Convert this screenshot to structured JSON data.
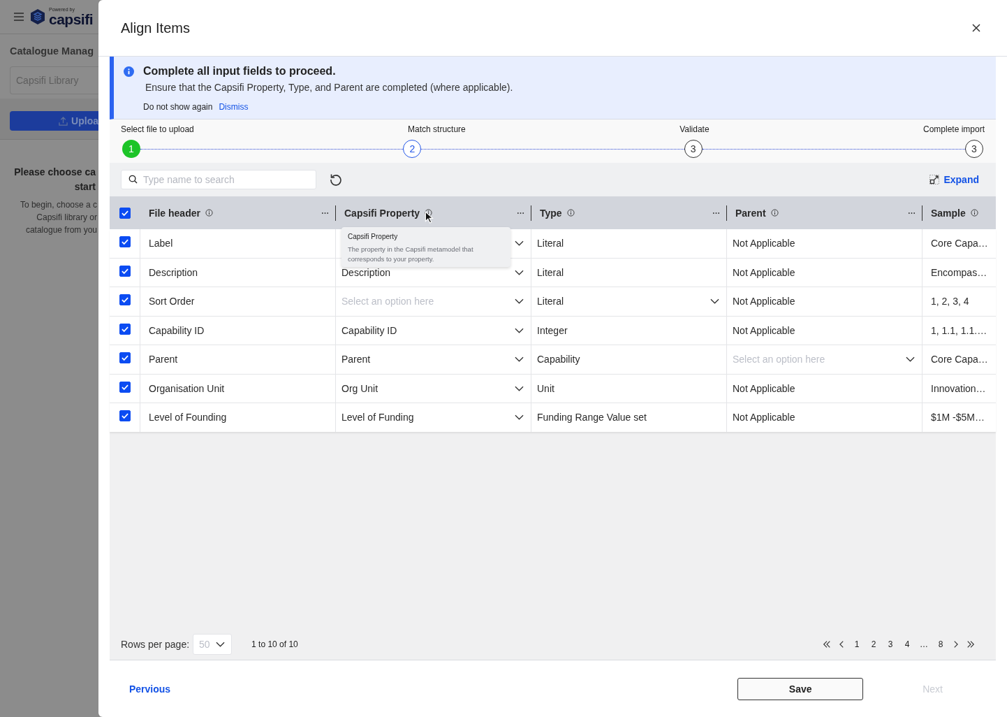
{
  "background_page": {
    "logo": {
      "tagline": "Powered by",
      "name": "capsifi"
    },
    "title": "Catalogue Manag",
    "library_field": {
      "placeholder": "Capsifi Library"
    },
    "upload_button": "Uploa",
    "empty_state": {
      "heading_lines": [
        "Please choose ca",
        "start"
      ],
      "body_lines": [
        "To begin, choose a c",
        "Capsifi library or",
        "catalogue from you"
      ]
    }
  },
  "dialog": {
    "title": "Align Items"
  },
  "alert": {
    "title": "Complete all input fields to proceed.",
    "message": "Ensure that the Capsifi Property, Type, and Parent are completed (where applicable).",
    "opt_out": "Do not show again",
    "dismiss": "Dismiss"
  },
  "steps": [
    {
      "label": "Select file to upload",
      "number": "1",
      "completed": true,
      "selected": false
    },
    {
      "label": "Match structure",
      "number": "2",
      "completed": false,
      "selected": true
    },
    {
      "label": "Validate",
      "number": "3",
      "completed": false,
      "selected": false
    },
    {
      "label": "Complete import",
      "number": "3",
      "completed": false,
      "selected": false
    }
  ],
  "search": {
    "placeholder": "Type name to search"
  },
  "expand": "Expand",
  "table": {
    "all_checked": true,
    "columns": [
      {
        "label": "File header",
        "menu": true
      },
      {
        "label": "Capsifi Property",
        "menu": true
      },
      {
        "label": "Type",
        "menu": true
      },
      {
        "label": "Parent",
        "menu": true
      },
      {
        "label": "Sample",
        "menu": false
      }
    ],
    "rows": [
      {
        "checked": true,
        "file_header": "Label",
        "property": {
          "dropdown": true
        },
        "type": {
          "value": "Literal",
          "dropdown": false
        },
        "parent": {
          "value": "Not Applicable",
          "dropdown": false
        },
        "sample": "Core Capa…"
      },
      {
        "checked": true,
        "file_header": "Description",
        "property": {
          "value": "Description",
          "dropdown": true
        },
        "type": {
          "value": "Literal",
          "dropdown": false
        },
        "parent": {
          "value": "Not Applicable",
          "dropdown": false
        },
        "sample": "Encompas…"
      },
      {
        "checked": true,
        "file_header": "Sort Order",
        "property": {
          "placeholder": "Select an option here",
          "dropdown": true
        },
        "type": {
          "value": "Literal",
          "dropdown": true
        },
        "parent": {
          "value": "Not Applicable",
          "dropdown": false
        },
        "sample": "1, 2, 3, 4"
      },
      {
        "checked": true,
        "file_header": "Capability ID",
        "property": {
          "value": "Capability ID",
          "dropdown": true
        },
        "type": {
          "value": "Integer",
          "dropdown": false
        },
        "parent": {
          "value": "Not Applicable",
          "dropdown": false
        },
        "sample": "1, 1.1, 1.1.…"
      },
      {
        "checked": true,
        "file_header": "Parent",
        "property": {
          "value": "Parent",
          "dropdown": true
        },
        "type": {
          "value": "Capability",
          "dropdown": false
        },
        "parent": {
          "placeholder": "Select an option here",
          "dropdown": true
        },
        "sample": "Core Capa…"
      },
      {
        "checked": true,
        "file_header": "Organisation Unit",
        "property": {
          "value": "Org Unit",
          "dropdown": true
        },
        "type": {
          "value": "Unit",
          "dropdown": false
        },
        "parent": {
          "value": "Not Applicable",
          "dropdown": false
        },
        "sample": "Innovation…"
      },
      {
        "checked": true,
        "file_header": "Level of Founding",
        "property": {
          "value": "Level of Funding",
          "dropdown": true
        },
        "type": {
          "value": "Funding Range Value set",
          "dropdown": false
        },
        "parent": {
          "value": "Not Applicable",
          "dropdown": false
        },
        "sample": "$1M -$5M…"
      }
    ]
  },
  "tooltip": {
    "title": "Capsifi Property",
    "text": "The property in the Capsifi metamodel that corresponds to your property."
  },
  "pagination": {
    "rows_label": "Rows per page:",
    "rows_value": "50",
    "range": "1 to 10 of 10",
    "pages": [
      "1",
      "2",
      "3",
      "4",
      "…",
      "8"
    ]
  },
  "actions": {
    "previous": "Pervious",
    "save": "Save",
    "next": {
      "label": "Next",
      "disabled": true
    }
  }
}
